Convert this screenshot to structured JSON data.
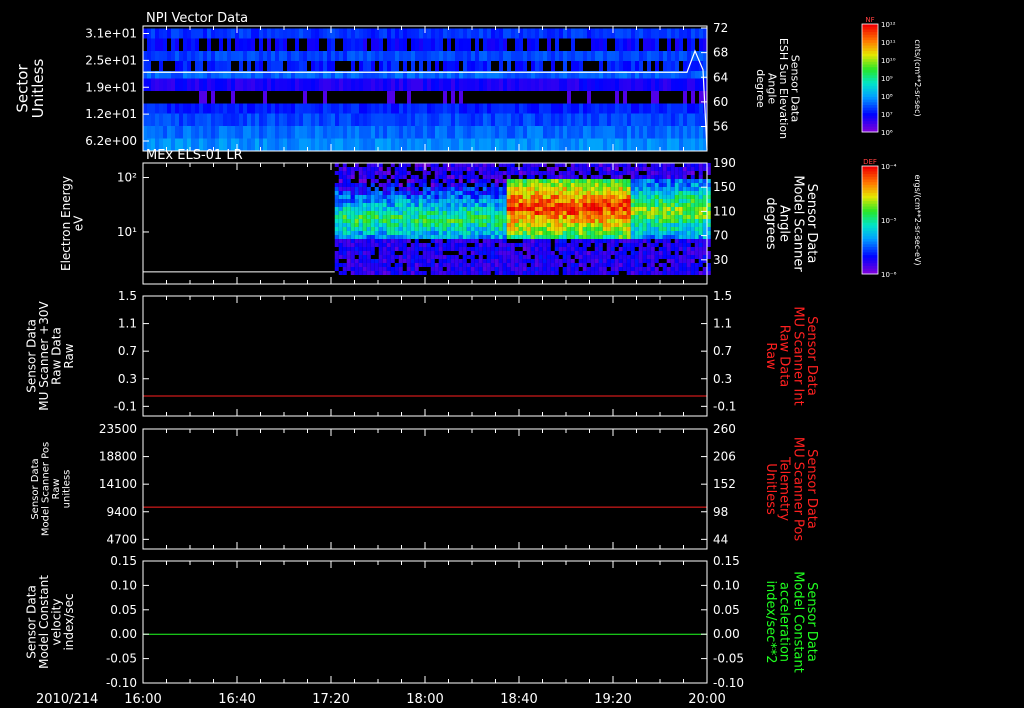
{
  "colors": {
    "background": "#000000",
    "foreground": "#ffffff",
    "red": "#ff2020",
    "green": "#20ff20"
  },
  "chart_data": [
    {
      "type": "heatmap",
      "title": "NPI Vector Data",
      "ylabel": "Sector\nUnitless",
      "yticks": [
        "3.1e+01",
        "2.5e+01",
        "1.9e+01",
        "1.2e+01",
        "6.2e+00"
      ],
      "y2label": "Sensor Data\nESH Sun Elevation\nAngle\ndegree",
      "y2ticks": [
        "72",
        "68",
        "64",
        "60",
        "56"
      ],
      "colorbar": {
        "label": "NF",
        "units": "cnts/(cm**2-sr-sec)",
        "ticks": [
          "10¹²",
          "10¹¹",
          "10¹⁰",
          "10⁹",
          "10⁸",
          "10⁷",
          "10⁶"
        ]
      },
      "overlay_line": {
        "name": "ESH Sun Elevation Angle",
        "color": "#ffffff"
      }
    },
    {
      "type": "heatmap",
      "title": "MEx ELS-01 LR",
      "ylabel": "Electron Energy\neV",
      "yticks": [
        "10²",
        "10¹"
      ],
      "y2label": "Sensor Data\nModel Scanner\nAngle\ndegrees",
      "y2ticks": [
        "190",
        "150",
        "110",
        "70",
        "30"
      ],
      "colorbar": {
        "label": "DEF",
        "units": "ergs/(cm**2-sr-sec-eV)",
        "ticks": [
          "10⁻⁴",
          "10⁻⁵",
          "10⁻⁶"
        ]
      }
    },
    {
      "type": "line",
      "ylabel": "Sensor Data\nMU Scanner +30V\nRaw Data\nRaw",
      "yticks": [
        "1.5",
        "1.1",
        "0.7",
        "0.3",
        "-0.1"
      ],
      "ylim": [
        -0.3,
        1.5
      ],
      "y2label": "Sensor Data\nMU Scanner Int\nRaw Data\nRaw",
      "y2ticks": [
        "1.5",
        "1.1",
        "0.7",
        "0.3",
        "-0.1"
      ],
      "series": [
        {
          "color": "#ff2020",
          "values": [
            0.0,
            0.0
          ]
        }
      ]
    },
    {
      "type": "line",
      "ylabel": "Sensor Data\nModel Scanner Pos\nRaw\nunitless",
      "yticks": [
        "23500",
        "18800",
        "14100",
        "9400",
        "4700"
      ],
      "ylim": [
        0,
        23500
      ],
      "y2label": "Sensor Data\nMU Scanner Pos\nTelemetry\nUnitless",
      "y2ticks": [
        "260",
        "206",
        "152",
        "98",
        "44"
      ],
      "series": [
        {
          "color": "#ff2020",
          "values": [
            8200,
            8200
          ]
        }
      ]
    },
    {
      "type": "line",
      "ylabel": "Sensor Data\nModel Constant\nvelocity\nindex/sec",
      "yticks": [
        "0.15",
        "0.10",
        "0.05",
        "0.00",
        "-0.05",
        "-0.10"
      ],
      "ylim": [
        -0.1,
        0.15
      ],
      "y2label": "Sensor Data\nModel Constant\nacceleration\nindex/sec**2",
      "y2ticks": [
        "0.15",
        "0.10",
        "0.05",
        "0.00",
        "-0.05",
        "-0.10"
      ],
      "series": [
        {
          "color": "#20ff20",
          "values": [
            0.0,
            0.0
          ]
        }
      ]
    }
  ],
  "xaxis": {
    "date": "2010/214",
    "ticks": [
      "16:00",
      "16:40",
      "17:20",
      "18:00",
      "18:40",
      "19:20",
      "20:00"
    ]
  }
}
